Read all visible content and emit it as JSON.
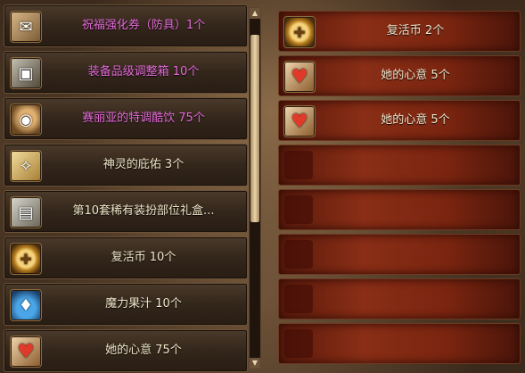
{
  "left_items": [
    {
      "label": "祝福强化券（防具）1个",
      "icon": "coupon-icon",
      "pink": true
    },
    {
      "label": "装备品级调整箱 10个",
      "icon": "box-icon",
      "pink": true
    },
    {
      "label": "赛丽亚的特调酷饮 75个",
      "icon": "drink-icon",
      "pink": true
    },
    {
      "label": "神灵的庇佑 3个",
      "icon": "blessing-icon",
      "pink": false
    },
    {
      "label": "第10套稀有装扮部位礼盒...",
      "icon": "gift-box-icon",
      "pink": false
    },
    {
      "label": "复活币 10个",
      "icon": "revive-coin-icon",
      "pink": false
    },
    {
      "label": "魔力果汁 10个",
      "icon": "juice-icon",
      "pink": false
    },
    {
      "label": "她的心意 75个",
      "icon": "heart-icon",
      "pink": false
    }
  ],
  "right_items": [
    {
      "label": "复活币 2个",
      "icon": "revive-coin-icon"
    },
    {
      "label": "她的心意 5个",
      "icon": "heart-icon"
    },
    {
      "label": "她的心意 5个",
      "icon": "heart-icon"
    },
    {
      "label": "",
      "icon": ""
    },
    {
      "label": "",
      "icon": ""
    },
    {
      "label": "",
      "icon": ""
    },
    {
      "label": "",
      "icon": ""
    },
    {
      "label": "",
      "icon": ""
    }
  ],
  "scrollbar": {
    "up": "▲",
    "down": "▼"
  }
}
